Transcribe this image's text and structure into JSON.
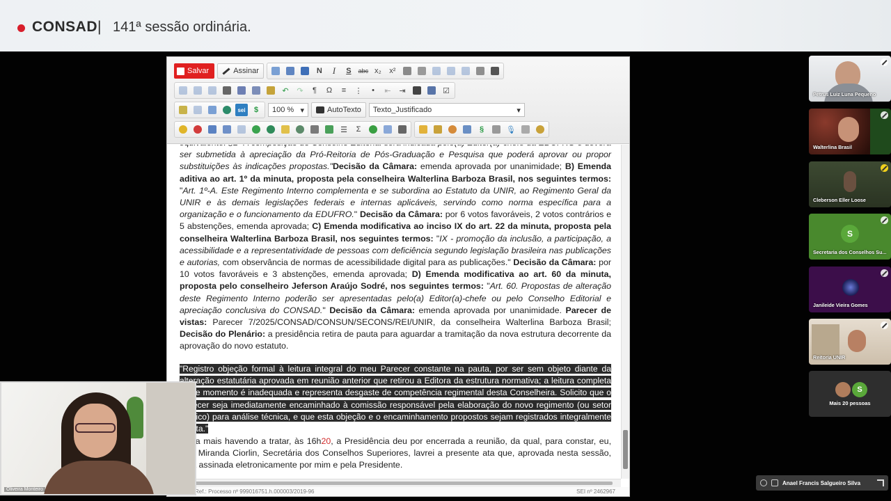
{
  "banner": {
    "brand": "CONSAD",
    "separator": "|",
    "session": "141ª sessão ordinária."
  },
  "toolbar": {
    "save_label": "Salvar",
    "sign_label": "Assinar",
    "bold_glyph": "N",
    "italic_glyph": "I",
    "underline_glyph": "S",
    "strike_glyph": "abc",
    "omega_glyph": "Ω",
    "sigma_glyph": "Σ",
    "para_glyph": "¶",
    "dollar_glyph": "$",
    "sei_label": "sei",
    "section_glyph": "§",
    "zoom_value": "100 %",
    "autotexto_label": "AutoTexto",
    "style_value": "Texto_Justificado"
  },
  "document": {
    "p1": {
      "t01": "equivalente. §2º A composição do Conselho Editorial será indicada pelo(a) Editor(a)-chefe da EDUFRO e deverá ser submetida à apreciação da Pró-Reitoria de Pós-Graduação e Pesquisa que poderá aprovar ou propor substituições às indicações propostas.\"",
      "t02": "Decisão da Câmara:",
      "t03": " emenda aprovada por unanimidade; ",
      "t04": "B) Emenda aditiva ao art. 1º da minuta, proposta pela conselheira Walterlina Barboza Brasil, nos seguintes termos:",
      "t05": " \"",
      "t06": "Art. 1º-A. Este Regimento Interno complementa e se subordina ao Estatuto da UNIR, ao Regimento Geral da UNIR e às demais legislações federais e internas aplicáveis, servindo como norma específica para a organização e o funcionamento da EDUFRO.",
      "t07": "\" ",
      "t08": "Decisão da Câmara:",
      "t09": " por 6 votos favoráveis, 2 votos contrários e 5 abstenções, emenda aprovada; ",
      "t10": "C) Emenda modificativa ao inciso IX do art. 22 da minuta, proposta pela conselheira Walterlina Barboza Brasil, nos seguintes termos:",
      "t11": " \"",
      "t12": "IX - promoção da inclusão, a participação, a acessibilidade e a representatividade de pessoas com deficiência segundo legislação brasileira nas publicações e autorias,",
      "t13": " com observância de normas de acessibilidade digital para as publicações.\" ",
      "t14": "Decisão da Câmara:",
      "t15": " por 10 votos favoráveis e 3 abstenções, emenda aprovada; ",
      "t16": "D) Emenda modificativa ao art. 60 da minuta, proposta pelo conselheiro Jeferson Araújo Sodré, nos seguintes termos:",
      "t17": " \"",
      "t18": "Art. 60. Propostas de alteração deste Regimento Interno poderão ser apresentadas pelo(a) Editor(a)-chefe ou pelo Conselho Editorial e apreciação conclusiva do CONSAD.",
      "t19": "\" ",
      "t20": "Decisão da Câmara:",
      "t21": " emenda aprovada por unanimidade. ",
      "t22": "Parecer de vistas:",
      "t23": " Parecer 7/2025/CONSAD/CONSUN/SECONS/REI/UNIR, da conselheira Walterlina Barboza Brasil; ",
      "t24": "Decisão do Plenário:",
      "t25": " a presidência retira de pauta para aguardar a tramitação da nova estrutura decorrente da aprovação do novo estatuto."
    },
    "highlight": "\"Registro objeção formal à leitura integral do meu Parecer constante na pauta, por ser sem objeto diante da alteração estatutária aprovada em reunião anterior que retirou a Editora da estrutura normativa; a leitura completa neste momento é inadequada e representa desgaste de competência regimental desta Conselheira. Solicito que o Parecer seja imediatamente encaminhado à comissão responsável pela elaboração do novo regimento (ou setor jurídico) para análise técnica, e que esta objeção e o encaminhamento propostos sejam registrados integralmente na ata.\"",
    "closing": {
      "a": "Nada mais havendo a tratar, às 16h",
      "b": "20",
      "c": ", a Presidência deu por encerrada a reunião, da qual, para constar, eu, Ana Miranda Ciorlin, Secretária dos Conselhos Superiores, lavrei a presente ata que, aprovada nesta sessão, será assinada eletronicamente por mim e pela Presidente."
    },
    "footer_left": "Ref.: Processo nº 999016751.h.000003/2019-96",
    "footer_right": "SEI nº 2462967"
  },
  "presenter": {
    "name": "Oliveira Monteiro"
  },
  "participants": [
    {
      "name": "Petrus Luiz Luna Pequeno"
    },
    {
      "name": "Walterlina Brasil"
    },
    {
      "name": "Cleberson Eller Loose"
    },
    {
      "name": "Secretaria dos Conselhos Su...",
      "initial": "S"
    },
    {
      "name": "Janileide Vieira Gomes"
    },
    {
      "name": "Reitoria UNIR"
    }
  ],
  "more": {
    "label": "Mais 20 pessoas",
    "initial": "S"
  },
  "speaker_bar": {
    "name": "Anael Francis Salgueiro Silva"
  },
  "colors": {
    "save": "#e02020",
    "banner_dot": "#d81e2b",
    "highlight_bg": "#2b2b2b",
    "time_red": "#d12b2b"
  }
}
